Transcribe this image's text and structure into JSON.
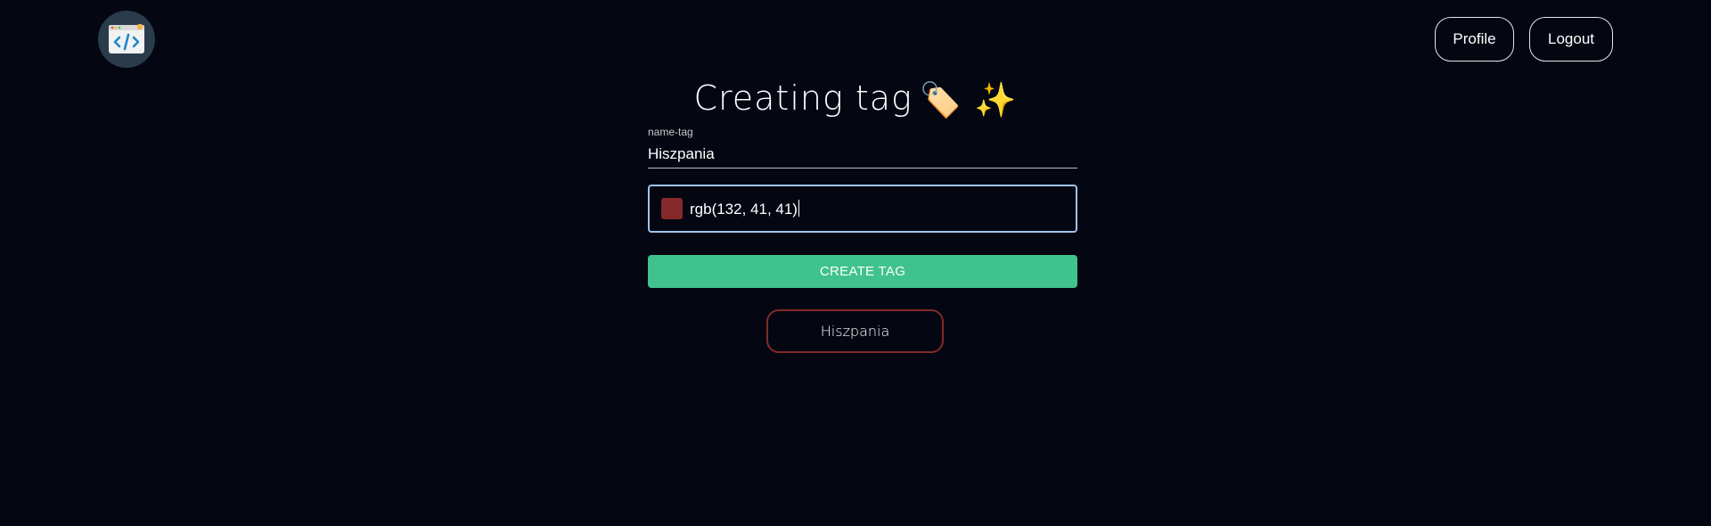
{
  "header": {
    "logo_icon": "code-window-icon",
    "profile_label": "Profile",
    "logout_label": "Logout"
  },
  "title": {
    "text": "Creating tag",
    "emojis": "🏷️ ✨"
  },
  "form": {
    "name_label": "name-tag",
    "name_value": "Hiszpania",
    "color_value": "rgb(132, 41, 41)",
    "swatch_color": "#842929",
    "submit_label": "CREATE TAG"
  },
  "preview": {
    "tag_label": "Hiszpania",
    "border_color": "#842929"
  }
}
